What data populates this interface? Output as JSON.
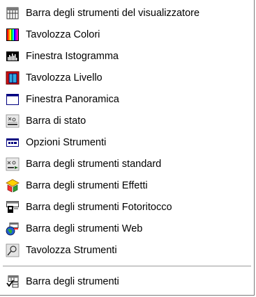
{
  "menu": {
    "items": [
      {
        "label": "Barra degli strumenti del visualizzatore",
        "icon": "viewer-toolbar-icon"
      },
      {
        "label": "Tavolozza Colori",
        "icon": "color-palette-icon"
      },
      {
        "label": "Finestra Istogramma",
        "icon": "histogram-icon"
      },
      {
        "label": "Tavolozza Livello",
        "icon": "layers-palette-icon"
      },
      {
        "label": "Finestra Panoramica",
        "icon": "overview-window-icon"
      },
      {
        "label": "Barra di stato",
        "icon": "status-bar-icon"
      },
      {
        "label": "Opzioni Strumenti",
        "icon": "tool-options-icon"
      },
      {
        "label": "Barra degli strumenti standard",
        "icon": "standard-toolbar-icon"
      },
      {
        "label": "Barra degli strumenti Effetti",
        "icon": "effects-toolbar-icon"
      },
      {
        "label": "Barra degli strumenti Fotoritocco",
        "icon": "photo-retouch-toolbar-icon"
      },
      {
        "label": "Barra degli strumenti Web",
        "icon": "web-toolbar-icon"
      },
      {
        "label": "Tavolozza Strumenti",
        "icon": "tools-palette-icon"
      }
    ],
    "footer_item": {
      "label": "Barra degli strumenti",
      "icon": "toolbar-customize-icon"
    }
  }
}
